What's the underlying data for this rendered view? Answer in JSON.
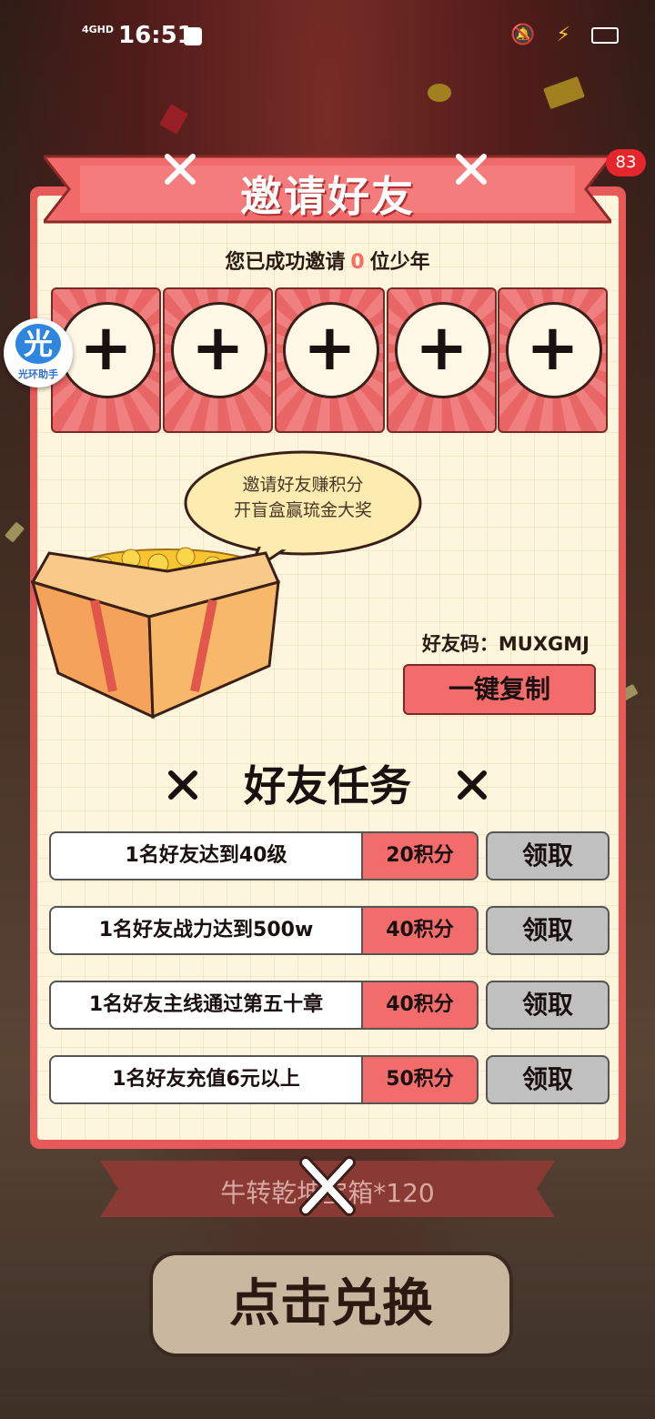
{
  "status_bar": {
    "network": "4GHD",
    "time": "16:51",
    "icons": [
      "bell-off-icon",
      "charging-icon",
      "battery-icon"
    ]
  },
  "assistant_badge": {
    "glyph": "光",
    "label": "光环助手"
  },
  "notification_count": "83",
  "header": {
    "title": "邀请好友"
  },
  "invite_status": {
    "prefix": "您已成功邀请",
    "count": "0",
    "suffix": "位少年"
  },
  "invite_slots": [
    "+",
    "+",
    "+",
    "+",
    "+"
  ],
  "speech_bubble": {
    "line1": "邀请好友赚积分",
    "line2": "开盲盒赢琉金大奖"
  },
  "friend_code": {
    "label": "好友码：MUXGMJ"
  },
  "copy_button": "一键复制",
  "tasks_title": "好友任务",
  "tasks": [
    {
      "desc": "1名好友达到40级",
      "points": "20积分",
      "action": "领取"
    },
    {
      "desc": "1名好友战力达到500w",
      "points": "40积分",
      "action": "领取"
    },
    {
      "desc": "1名好友主线通过第五十章",
      "points": "40积分",
      "action": "领取"
    },
    {
      "desc": "1名好友充值6元以上",
      "points": "50积分",
      "action": "领取"
    }
  ],
  "background": {
    "reward_ribbon": "牛转乾坤宝箱*120",
    "exchange_button": "点击兑换"
  },
  "colors": {
    "panel_red": "#e65a5a",
    "panel_cream": "#fdf5dc",
    "points_red": "#f26c6c",
    "claim_gray": "#c0c0c0",
    "count_highlight": "#ff6a63",
    "badge_red": "#e6262d"
  }
}
